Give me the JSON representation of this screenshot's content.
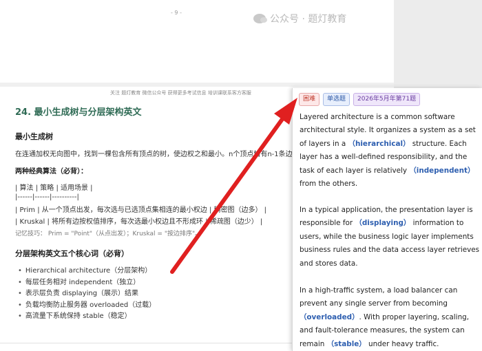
{
  "doc": {
    "page_number": "- 9 -",
    "watermark": "公众号 · 题灯教育",
    "header_note": "关注 题灯教育 微信公众号 获得更多考试信息 培训课联系客方客服",
    "section_title": "24. 最小生成树与分层架构英文",
    "mst_heading": "最小生成树",
    "mst_definition": "在连通加权无向图中，找到一棵包含所有顶点的树，使边权之和最小。n个顶点恰有n-1条边。",
    "algorithms_heading": "两种经典算法（必背）：",
    "table_header": "| 算法 | 策略 | 适用场景 |",
    "table_divider": "|------|------|----------|",
    "table_row_prim": "| Prim | 从一个顶点出发，每次选与已选顶点集相连的最小权边 | 稠密图（边多） |",
    "table_row_kruskal": "| Kruskal | 将所有边按权值排序，每次选最小权边且不形成环 | 稀疏图（边少） |",
    "memory_tip": "记忆技巧： Prim = \"Point\"（从点出发）；Kruskal = \"按边排序\"。",
    "arch_heading": "分层架构英文五个核心词（必背）",
    "arch_words": [
      "Hierarchical architecture（分层架构）",
      "每层任务相对 independent（独立）",
      "表示层负责 displaying（展示）结果",
      "负载均衡防止服务器 overloaded（过载）",
      "高流量下系统保持 stable（稳定）"
    ]
  },
  "card": {
    "tags": [
      "困难",
      "单选题",
      "2026年5月年第71题"
    ],
    "p1": {
      "a": "Layered architecture is a common software architectural style. It organizes a system as a set of layers in a ",
      "k1": "（hierarchical）",
      "b": " structure. Each layer has a well-defined responsibility, and the task of each layer is relatively ",
      "k2": "（independent）",
      "c": " from the others."
    },
    "p2": {
      "a": "In a typical application, the presentation layer is responsible for ",
      "k1": "（displaying）",
      "b": " information to users, while the business logic layer implements business rules and the data access layer retrieves and stores data."
    },
    "p3": {
      "a": "In a high-traffic system, a load balancer can prevent any single server from becoming ",
      "k1": "（overloaded）",
      "b": ". With proper layering, scaling, and fault-tolerance measures, the system can remain ",
      "k2": "（stable）",
      "c": " under heavy traffic."
    }
  },
  "colors": {
    "arrow": "#e02020",
    "title_green": "#2f6b55",
    "keyword_blue": "#2e5fb0"
  }
}
